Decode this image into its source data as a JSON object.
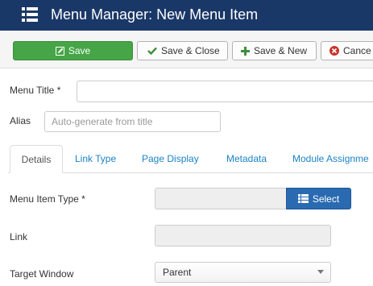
{
  "header": {
    "title": "Menu Manager: New Menu Item",
    "icon": "menu-list-icon",
    "background": "#1a3867"
  },
  "toolbar": {
    "save_label": "Save",
    "save_close_label": "Save & Close",
    "save_new_label": "Save & New",
    "cancel_label": "Cance",
    "save_color": "#46a546"
  },
  "form": {
    "menu_title_label": "Menu Title *",
    "menu_title_value": "",
    "alias_label": "Alias",
    "alias_placeholder": "Auto-generate from title"
  },
  "tabs": [
    {
      "label": "Details",
      "active": true
    },
    {
      "label": "Link Type",
      "active": false
    },
    {
      "label": "Page Display",
      "active": false
    },
    {
      "label": "Metadata",
      "active": false
    },
    {
      "label": "Module Assignme",
      "active": false
    }
  ],
  "details": {
    "menu_item_type_label": "Menu Item Type *",
    "menu_item_type_value": "",
    "select_button_label": "Select",
    "link_label": "Link",
    "link_value": "",
    "target_window_label": "Target Window",
    "target_window_value": "Parent"
  },
  "colors": {
    "link": "#1c83c6",
    "primary_button": "#2a6ab1",
    "cancel_icon": "#c7352b"
  }
}
